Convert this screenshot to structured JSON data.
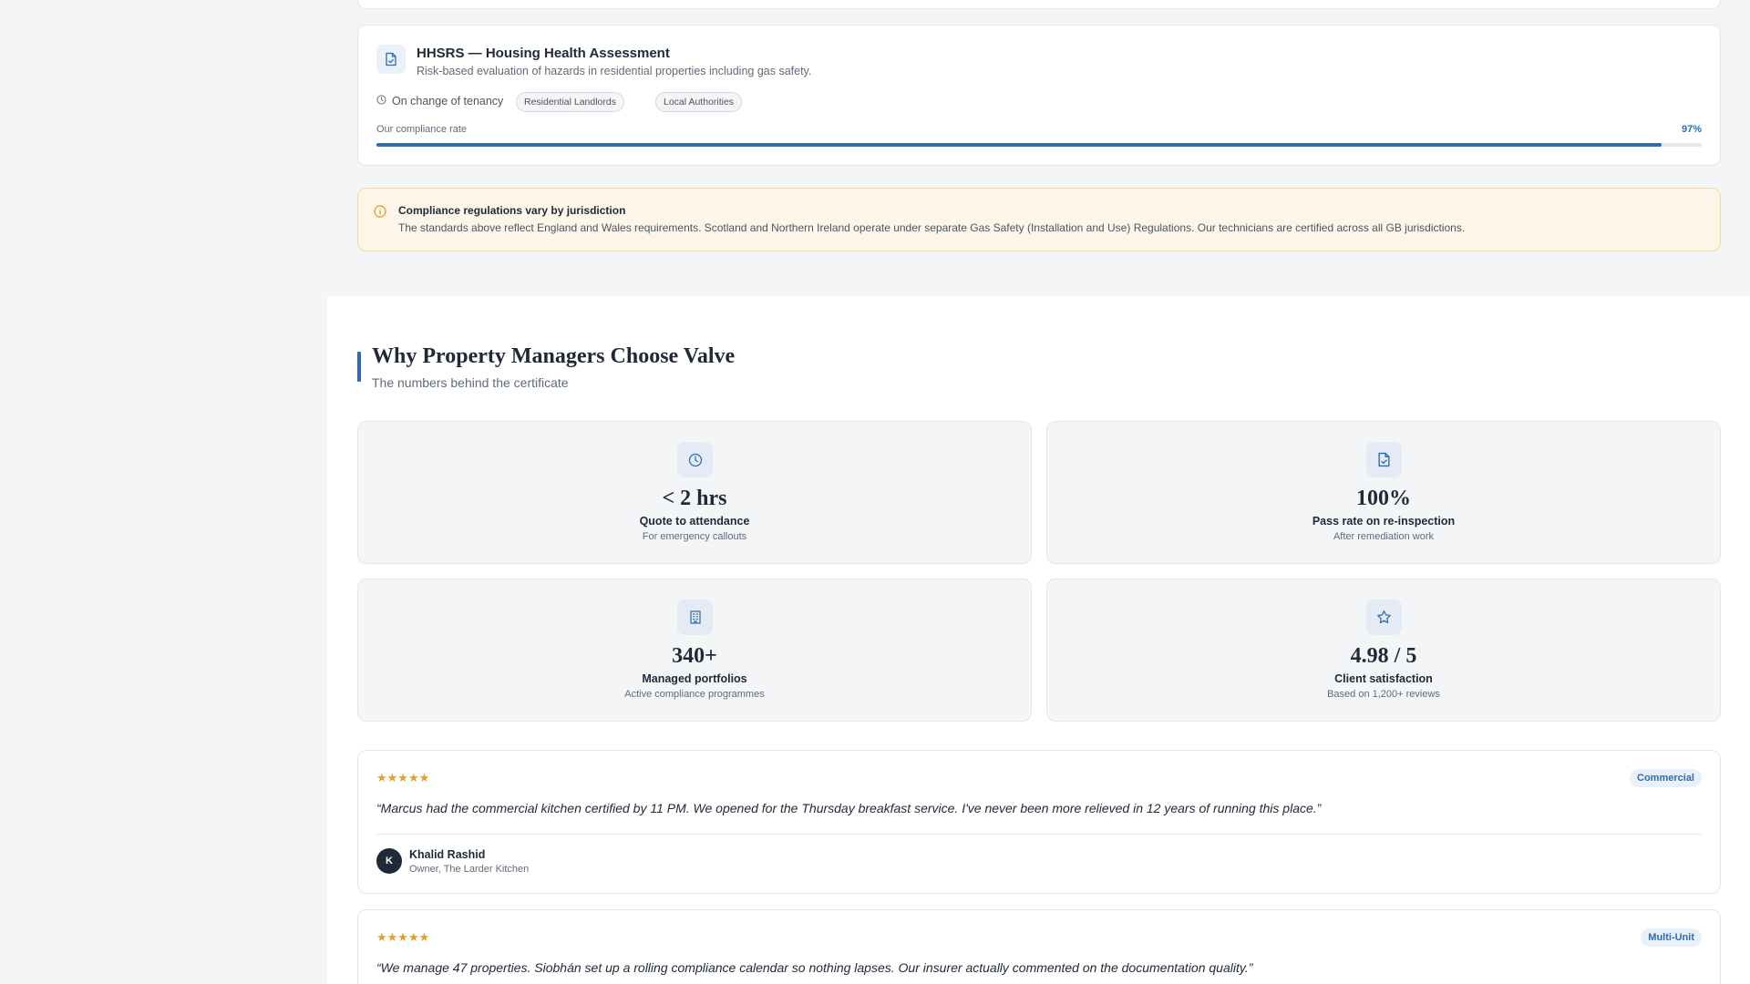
{
  "regulation": {
    "title": "HHSRS — Housing Health Assessment",
    "description": "Risk-based evaluation of hazards in residential properties including gas safety.",
    "frequency": "On change of tenancy",
    "tags": [
      "Residential Landlords",
      "Local Authorities"
    ],
    "compliance_label": "Our compliance rate",
    "compliance_value": "97%",
    "compliance_fraction": 0.97,
    "icon": "document-check-icon"
  },
  "notice": {
    "title": "Compliance regulations vary by jurisdiction",
    "body": "The standards above reflect England and Wales requirements. Scotland and Northern Ireland operate under separate Gas Safety (Installation and Use) Regulations. Our technicians are certified across all GB jurisdictions.",
    "icon": "info-icon"
  },
  "section": {
    "title": "Why Property Managers Choose Valve",
    "subtitle": "The numbers behind the certificate"
  },
  "stats": [
    {
      "value": "< 2 hrs",
      "label": "Quote to attendance",
      "sub": "For emergency callouts",
      "icon": "clock-icon"
    },
    {
      "value": "100%",
      "label": "Pass rate on re-inspection",
      "sub": "After remediation work",
      "icon": "document-check-icon"
    },
    {
      "value": "340+",
      "label": "Managed portfolios",
      "sub": "Active compliance programmes",
      "icon": "building-icon"
    },
    {
      "value": "4.98 / 5",
      "label": "Client satisfaction",
      "sub": "Based on 1,200+ reviews",
      "icon": "star-icon"
    }
  ],
  "testimonials": [
    {
      "stars": "★★★★★",
      "rating": 5,
      "badge": "Commercial",
      "quote": "“Marcus had the commercial kitchen certified by 11 PM. We opened for the Thursday breakfast service. I've never been more relieved in 12 years of running this place.”",
      "initial": "K",
      "name": "Khalid Rashid",
      "role": "Owner, The Larder Kitchen"
    },
    {
      "stars": "★★★★★",
      "rating": 5,
      "badge": "Multi-Unit",
      "quote": "“We manage 47 properties. Siobhán set up a rolling compliance calendar so nothing lapses. Our insurer actually commented on the documentation quality.”"
    }
  ],
  "colors": {
    "accent": "#2f6cad",
    "star": "#e0a028",
    "notice_bg": "#fdf6e8",
    "page_bg": "#f4f5f7"
  }
}
